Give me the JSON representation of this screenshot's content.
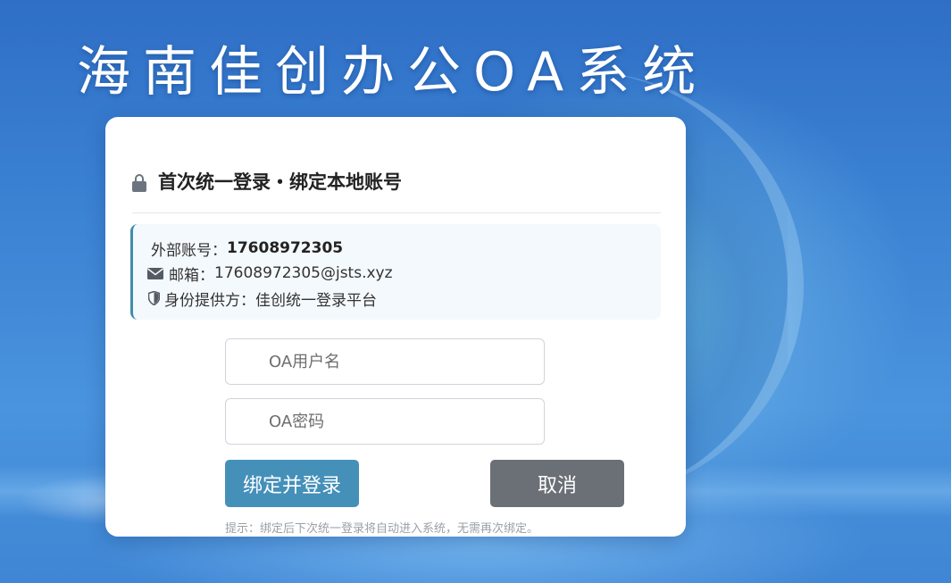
{
  "app_title": "海南佳创办公OA系统",
  "card": {
    "title": "首次统一登录・绑定本地账号",
    "info": {
      "external_account_label": "外部账号：",
      "external_account_value": "17608972305",
      "email_label": "邮箱：",
      "email_value": "17608972305@jsts.xyz",
      "provider_label": "身份提供方：",
      "provider_value": "佳创统一登录平台"
    },
    "username_placeholder": "OA用户名",
    "password_placeholder": "OA密码",
    "bind_button": "绑定并登录",
    "cancel_button": "取消",
    "hint": "提示：绑定后下次统一登录将自动进入系统，无需再次绑定。"
  },
  "icons": {
    "lock": "lock-icon",
    "mail": "envelope-icon",
    "shield": "shield-icon"
  },
  "colors": {
    "bind_button": "#4590b9",
    "cancel_button": "#6b6f76",
    "info_accent": "#3e8ea8"
  }
}
